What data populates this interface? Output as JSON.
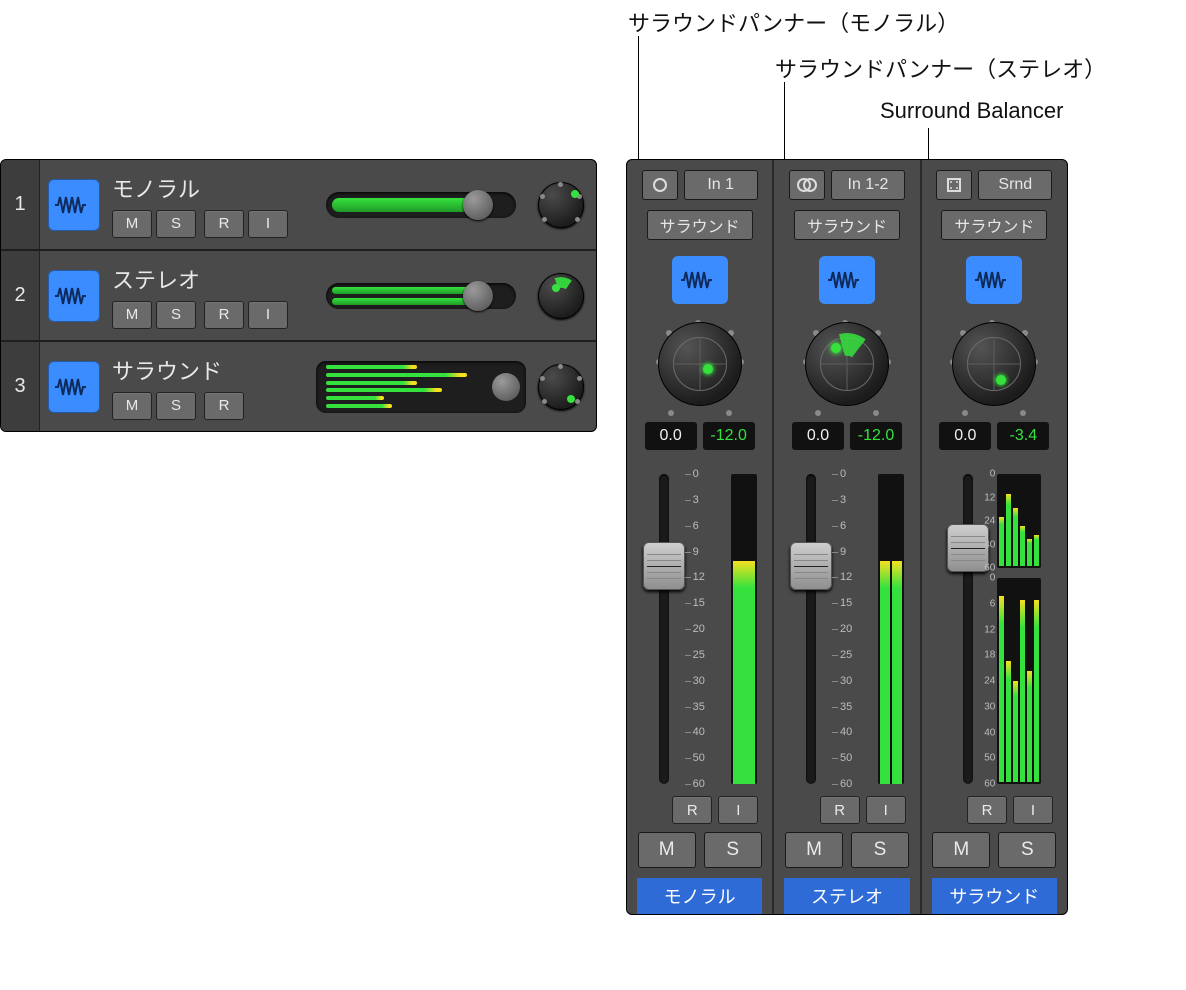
{
  "callouts": {
    "mono": "サラウンドパンナー（モノラル）",
    "stereo": "サラウンドパンナー（ステレオ）",
    "balancer": "Surround Balancer"
  },
  "tracks": [
    {
      "num": "1",
      "name": "モノラル",
      "buttons": [
        "M",
        "S",
        "R",
        "I"
      ],
      "slider": {
        "fill": 0.82,
        "cap": 0.8
      },
      "pan": {
        "type": "mono",
        "dot": [
          0.78,
          0.22
        ]
      }
    },
    {
      "num": "2",
      "name": "ステレオ",
      "buttons": [
        "M",
        "S",
        "R",
        "I"
      ],
      "slider": {
        "fill": 0.82,
        "cap": 0.8,
        "double": true
      },
      "pan": {
        "type": "stereo",
        "wedge": true,
        "dot": [
          0.34,
          0.3
        ]
      }
    },
    {
      "num": "3",
      "name": "サラウンド",
      "buttons": [
        "M",
        "S",
        "R"
      ],
      "meterBars": [
        0.55,
        0.85,
        0.55,
        0.7,
        0.35,
        0.4
      ],
      "pan": {
        "type": "surround",
        "dot": [
          0.68,
          0.72
        ]
      }
    }
  ],
  "strips": [
    {
      "io": {
        "icon": "mono-circle",
        "label": "In 1"
      },
      "route": "サラウンド",
      "panner": {
        "type": "mono",
        "dot": [
          0.6,
          0.56
        ]
      },
      "readout": {
        "gain": "0.0",
        "peak": "-12.0"
      },
      "fader": {
        "pos": 0.22,
        "meter": [
          0.72
        ]
      },
      "scale": [
        "0",
        "3",
        "6",
        "9",
        "12",
        "15",
        "20",
        "25",
        "30",
        "35",
        "40",
        "50",
        "60"
      ],
      "ri": [
        "R",
        "I"
      ],
      "ms": [
        "M",
        "S"
      ],
      "name": "モノラル"
    },
    {
      "io": {
        "icon": "stereo-circles",
        "label": "In 1-2"
      },
      "route": "サラウンド",
      "panner": {
        "type": "stereo",
        "dot": [
          0.36,
          0.3
        ],
        "wedge": true
      },
      "readout": {
        "gain": "0.0",
        "peak": "-12.0"
      },
      "fader": {
        "pos": 0.22,
        "meter": [
          0.72,
          0.72
        ]
      },
      "scale": [
        "0",
        "3",
        "6",
        "9",
        "12",
        "15",
        "20",
        "25",
        "30",
        "35",
        "40",
        "50",
        "60"
      ],
      "ri": [
        "R",
        "I"
      ],
      "ms": [
        "M",
        "S"
      ],
      "name": "ステレオ"
    },
    {
      "io": {
        "icon": "surround-icon",
        "label": "Srnd"
      },
      "route": "サラウンド",
      "panner": {
        "type": "surround",
        "dot": [
          0.58,
          0.7
        ]
      },
      "readout": {
        "gain": "0.0",
        "peak": "-3.4"
      },
      "surround": {
        "scaleTop": [
          "0",
          "12",
          "24",
          "40",
          "60"
        ],
        "scaleBot": [
          "0",
          "6",
          "12",
          "18",
          "24",
          "30",
          "40",
          "50",
          "60"
        ],
        "top": [
          0.55,
          0.8,
          0.65,
          0.45,
          0.3,
          0.35
        ],
        "bot": [
          0.92,
          0.6,
          0.5,
          0.9,
          0.55,
          0.9
        ]
      },
      "fader": {
        "pos": 0.16
      },
      "ri": [
        "R",
        "I"
      ],
      "ms": [
        "M",
        "S"
      ],
      "name": "サラウンド"
    }
  ]
}
